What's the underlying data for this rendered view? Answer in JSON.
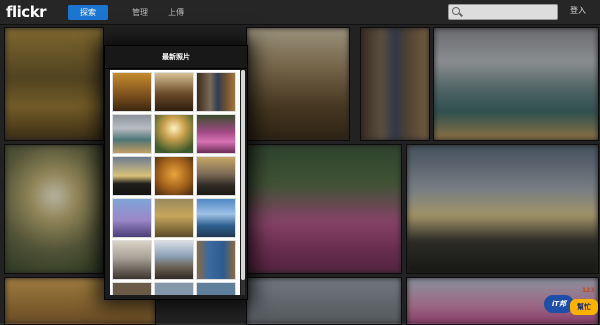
{
  "app": {
    "logo": "flickr",
    "nav": [
      {
        "label": "探索",
        "active": true
      },
      {
        "label": "管理",
        "active": false
      },
      {
        "label": "上傳",
        "active": false
      }
    ],
    "search_placeholder": "",
    "login_label": "登入"
  },
  "panel": {
    "title": "最新照片",
    "thumbnails": [
      {
        "name": "thumb-autumn-forest"
      },
      {
        "name": "thumb-bare-tree"
      },
      {
        "name": "thumb-man-in-doorway"
      },
      {
        "name": "thumb-sea-shore"
      },
      {
        "name": "thumb-tree-sunset"
      },
      {
        "name": "thumb-pink-flowers"
      },
      {
        "name": "thumb-rock-silhouette"
      },
      {
        "name": "thumb-autumn-tree"
      },
      {
        "name": "thumb-rocky-coast"
      },
      {
        "name": "thumb-lavender"
      },
      {
        "name": "thumb-hill-tree"
      },
      {
        "name": "thumb-blue-sea"
      },
      {
        "name": "thumb-stones"
      },
      {
        "name": "thumb-coast-rocks"
      },
      {
        "name": "thumb-blue-door"
      },
      {
        "name": "thumb-partial-1"
      },
      {
        "name": "thumb-partial-2"
      },
      {
        "name": "thumb-partial-3"
      }
    ]
  },
  "watermark": {
    "brand_a": "iT邦",
    "brand_b": "幫忙",
    "brand_c": "123"
  }
}
